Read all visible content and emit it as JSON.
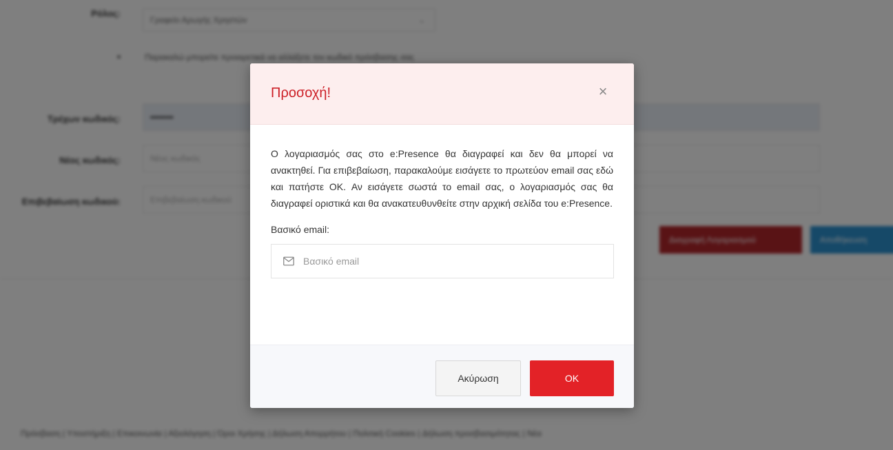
{
  "background": {
    "role_label": "Ρόλος:",
    "role_value": "Γραφείο Αρωγής Χρηστών",
    "info_text": "Παρακαλώ μπορείτε προαιρετικά να αλλάξετε τον κωδικό πρόσβασης σας",
    "current_password_label": "Τρέχων κωδικός:",
    "current_password_value": "••••••••",
    "new_password_label": "Νέος κωδικός:",
    "new_password_placeholder": "Νέος κωδικός",
    "confirm_password_label": "Επιβεβαίωση κωδικού:",
    "confirm_password_placeholder": "Επιβεβαίωση κωδικού",
    "delete_account_button": "Διαγραφή Λογαριασμού",
    "save_button": "Αποθήκευση",
    "footer_links": "Πρόσβαση  |  Υποστήριξη  |  Επικοινωνία  |  Αξιολόγηση  |  Όροι Χρήσης  |  Δήλωση Απορρήτου  |  Πολιτική Cookies  |  Δήλωση προσβασιμότητας  |  Νέα"
  },
  "modal": {
    "title": "Προσοχή!",
    "close_symbol": "×",
    "message": "Ο λογαριασμός σας στο e:Presence θα διαγραφεί και δεν θα μπορεί να ανακτηθεί. Για επιβεβαίωση, παρακαλούμε εισάγετε το πρωτεύον email σας εδώ και πατήστε OK. Αν εισάγετε σωστά το email σας, ο λογαριασμός σας θα διαγραφεί οριστικά και θα ανακατευθυνθείτε στην αρχική σελίδα του e:Presence.",
    "email_label": "Βασικό email:",
    "email_placeholder": "Βασικό email",
    "email_value": "",
    "email_icon": "envelope-icon",
    "cancel_label": "Ακύρωση",
    "ok_label": "OK"
  },
  "colors": {
    "title_red": "#cc1f26",
    "ok_red": "#e32227",
    "header_tint": "#fdeeee"
  }
}
